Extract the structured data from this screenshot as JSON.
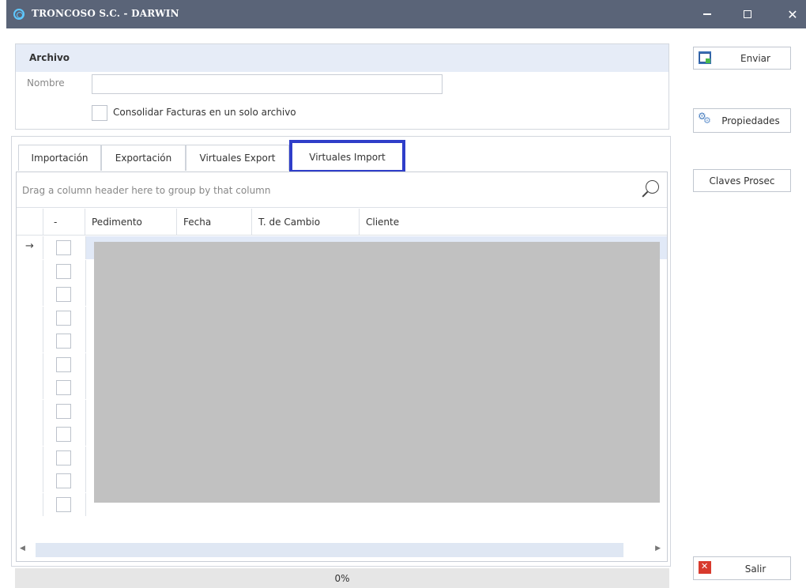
{
  "window": {
    "title": "TRONCOSO S.C. - DARWIN",
    "minimize": "—",
    "close": "✕"
  },
  "archivo": {
    "header": "Archivo",
    "nombre_label": "Nombre",
    "nombre_value": "",
    "consolidar_label": "Consolidar Facturas en un solo archivo",
    "consolidar_checked": false
  },
  "buttons": {
    "enviar": "Enviar",
    "propiedades": "Propiedades",
    "claves": "Claves Prosec",
    "salir": "Salir"
  },
  "tabs": [
    {
      "label": "Importación",
      "active": false
    },
    {
      "label": "Exportación",
      "active": false
    },
    {
      "label": "Virtuales Export",
      "active": false
    },
    {
      "label": "Virtuales Import",
      "active": true
    }
  ],
  "grid": {
    "group_hint": "Drag a column header here to group by that column",
    "columns": [
      "-",
      "Pedimento",
      "Fecha",
      "T. de Cambio",
      "Cliente"
    ],
    "current_row_indicator": "→",
    "visible_row_count": 12
  },
  "progress": {
    "label": "0%",
    "value": 0
  },
  "colors": {
    "titlebar": "#5a6478",
    "tab_highlight": "#2f3ec9",
    "group_header_bg": "#e6ecf7",
    "redaction": "#c1c1c1"
  }
}
